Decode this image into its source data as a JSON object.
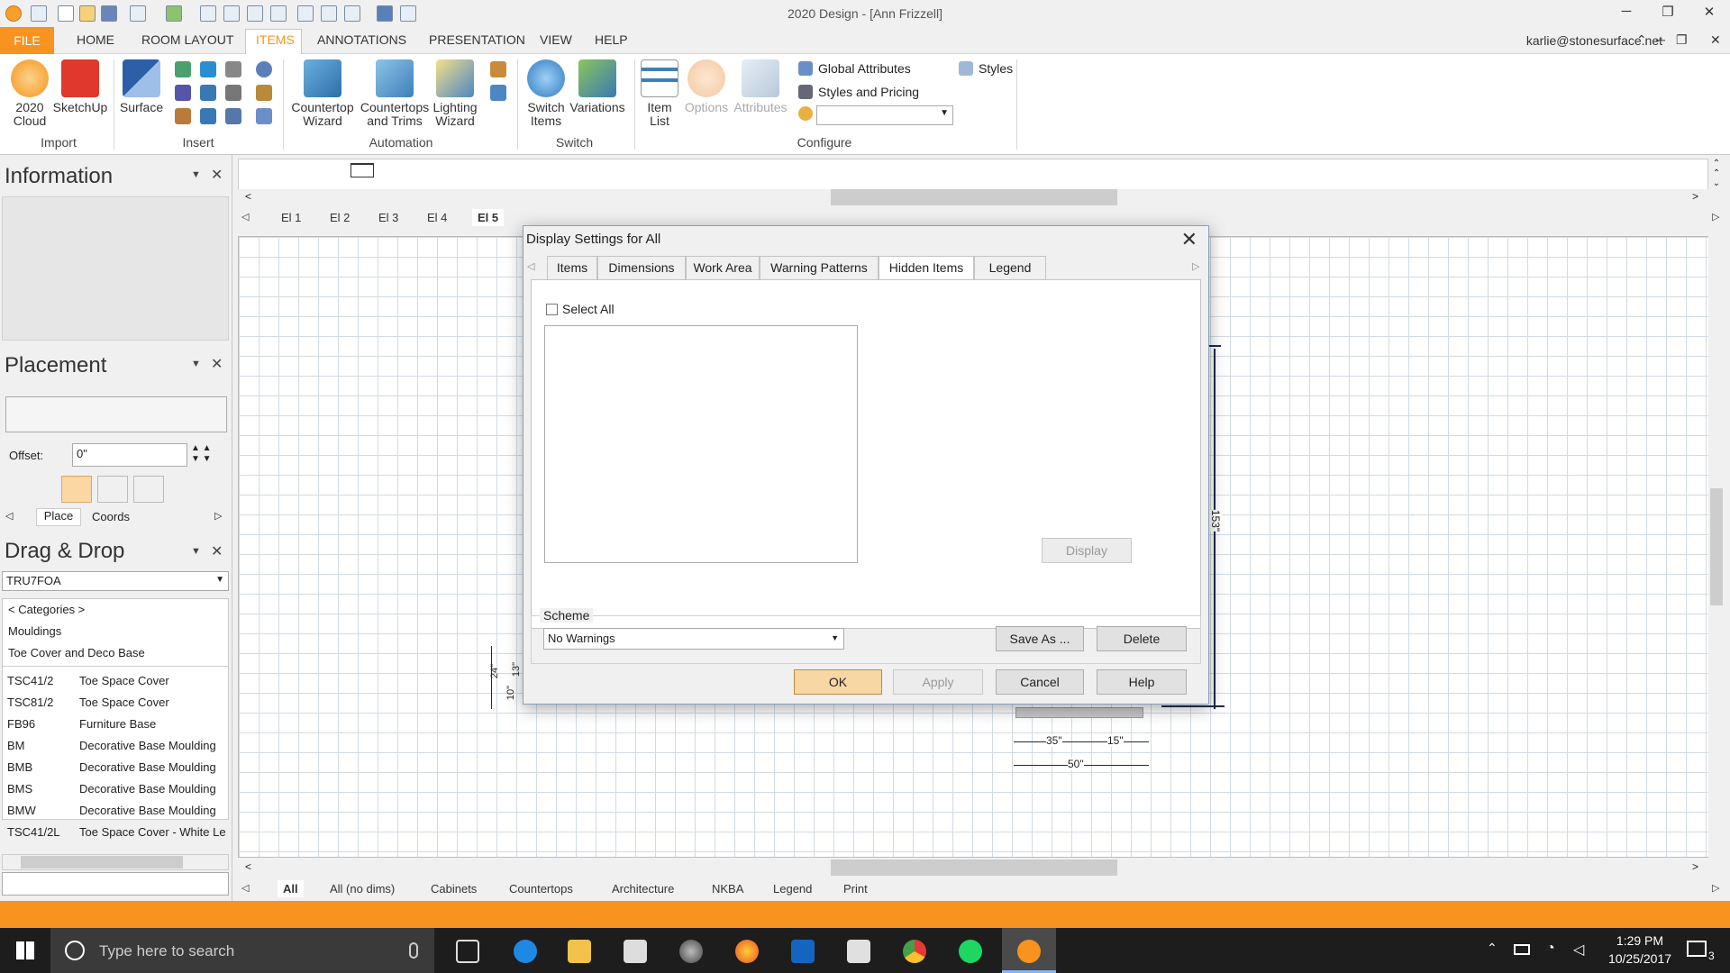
{
  "window": {
    "title": "2020 Design - [Ann Frizzell]",
    "account": "karlie@stonesurface.net"
  },
  "menu": [
    "FILE",
    "HOME",
    "ROOM LAYOUT",
    "ITEMS",
    "ANNOTATIONS",
    "PRESENTATION",
    "VIEW",
    "HELP"
  ],
  "ribbon": {
    "import": {
      "cloud_l1": "2020",
      "cloud_l2": "Cloud",
      "sketchup": "SketchUp",
      "group": "Import"
    },
    "insert": {
      "surface": "Surface",
      "group": "Insert"
    },
    "automation": {
      "cw_l1": "Countertop",
      "cw_l2": "Wizard",
      "ct_l1": "Countertops",
      "ct_l2": "and Trims",
      "lw_l1": "Lighting",
      "lw_l2": "Wizard",
      "group": "Automation"
    },
    "switch": {
      "si_l1": "Switch",
      "si_l2": "Items",
      "variations": "Variations",
      "group": "Switch"
    },
    "configure": {
      "il_l1": "Item",
      "il_l2": "List",
      "options": "Options",
      "attributes": "Attributes",
      "global": "Global Attributes",
      "styles_pricing": "Styles and Pricing",
      "styles": "Styles",
      "group": "Configure"
    }
  },
  "information": {
    "title": "Information"
  },
  "placement": {
    "title": "Placement",
    "offset_label": "Offset:",
    "offset_value": "0\"",
    "tab_place": "Place",
    "tab_coords": "Coords"
  },
  "dragdrop": {
    "title": "Drag & Drop",
    "catalog": "TRU7FOA",
    "categories": "< Categories >",
    "crumb1": "Mouldings",
    "crumb2": "Toe Cover and Deco Base",
    "items": [
      {
        "code": "TSC41/2",
        "desc": "Toe Space Cover"
      },
      {
        "code": "TSC81/2",
        "desc": "Toe Space Cover"
      },
      {
        "code": "FB96",
        "desc": "Furniture Base"
      },
      {
        "code": "BM",
        "desc": "Decorative Base Moulding"
      },
      {
        "code": "BMB",
        "desc": "Decorative Base Moulding"
      },
      {
        "code": "BMS",
        "desc": "Decorative Base Moulding"
      },
      {
        "code": "BMW",
        "desc": "Decorative Base Moulding"
      },
      {
        "code": "TSC41/2L",
        "desc": "Toe Space Cover - White Le"
      }
    ]
  },
  "elevation_tabs": [
    "El 1",
    "El 2",
    "El 3",
    "El 4",
    "El 5"
  ],
  "bottom_tabs": [
    "All",
    "All (no dims)",
    "Cabinets",
    "Countertops",
    "Architecture",
    "NKBA",
    "Legend",
    "Print"
  ],
  "dims": {
    "d24": "24\"",
    "d10": "10\"",
    "d13": "13\"",
    "d35": "35\"",
    "d15": "15\"",
    "d50": "50\"",
    "d153": "153\""
  },
  "dialog": {
    "title": "Display Settings for All",
    "tabs": [
      "Items",
      "Dimensions",
      "Work Area",
      "Warning Patterns",
      "Hidden Items",
      "Legend"
    ],
    "select_all": "Select All",
    "display": "Display",
    "scheme_label": "Scheme",
    "scheme_value": "No Warnings",
    "save_as": "Save As ...",
    "delete": "Delete",
    "ok": "OK",
    "apply": "Apply",
    "cancel": "Cancel",
    "help": "Help"
  },
  "taskbar": {
    "search": "Type here to search",
    "time": "1:29 PM",
    "date": "10/25/2017",
    "notif": "3"
  }
}
